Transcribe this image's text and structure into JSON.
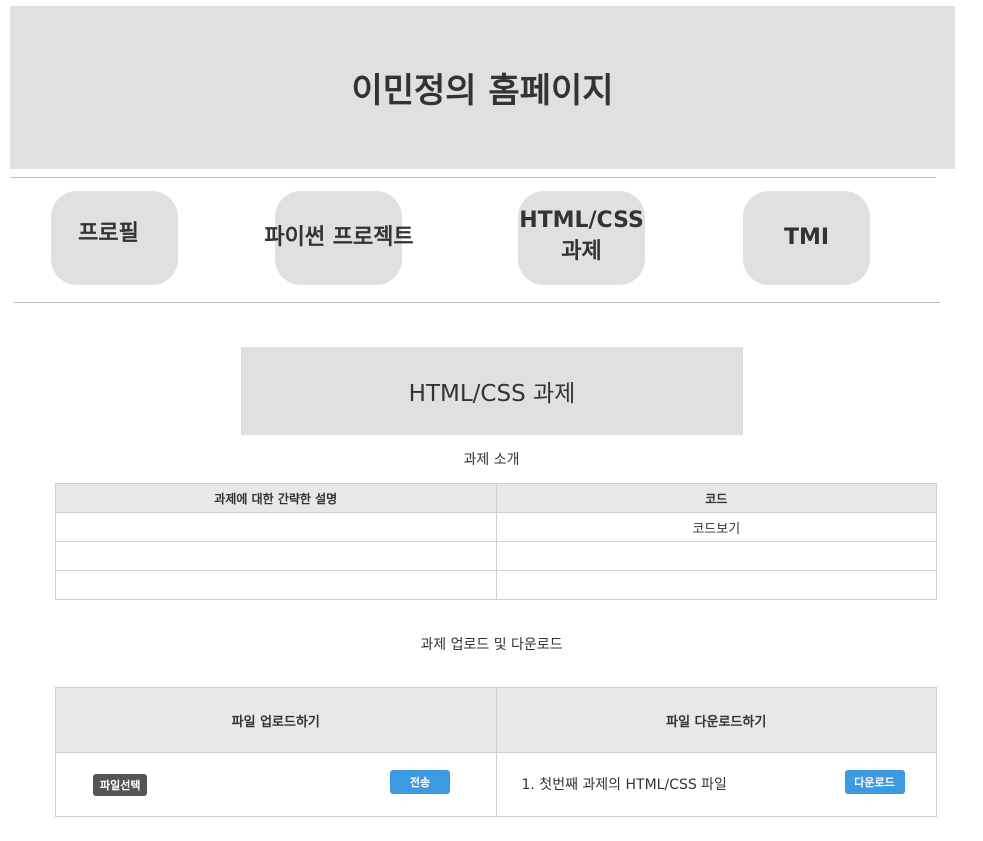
{
  "header": {
    "title": "이민정의 홈페이지"
  },
  "nav": {
    "items": [
      {
        "label": "프로필"
      },
      {
        "label": "파이썬 프로젝트"
      },
      {
        "label_line1": "HTML/CSS",
        "label_line2": "과제"
      },
      {
        "label": "TMI"
      }
    ]
  },
  "section": {
    "title": "HTML/CSS 과제"
  },
  "intro": {
    "caption": "과제 소개",
    "columns": [
      "과제에 대한 간략한 설명",
      "코드"
    ],
    "rows": [
      [
        "",
        "코드보기"
      ],
      [
        "",
        ""
      ],
      [
        "",
        ""
      ]
    ]
  },
  "files": {
    "caption": "과제 업로드 및 다운로드",
    "upload_header": "파일 업로드하기",
    "download_header": "파일 다운로드하기",
    "choose_file_label": "파일선택",
    "send_label": "전송",
    "download_item": "1. 첫번째 과제의 HTML/CSS 파일",
    "download_label": "다운로드"
  },
  "colors": {
    "panel": "#e0e0e0",
    "accent_blue": "#3c9be0",
    "dark_button": "#555555"
  }
}
